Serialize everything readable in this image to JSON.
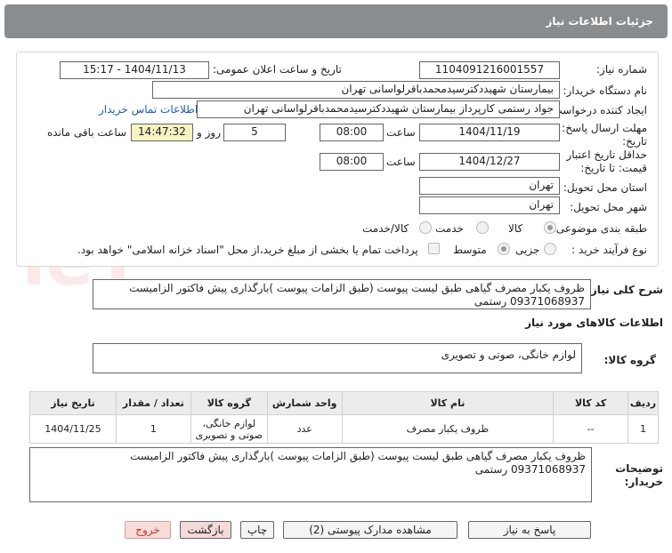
{
  "header": {
    "title": "جزئیات اطلاعات نیاز"
  },
  "form": {
    "need_number_label": "شماره نیاز:",
    "need_number": "1104091216001557",
    "announce_label": "تاریخ و ساعت اعلان عمومی:",
    "announce_value": "1404/11/13 - 15:17",
    "buyer_org_label": "نام دستگاه خریدار:",
    "buyer_org": "بیمارستان شهیددکترسیدمحمدباقرلواسانی تهران",
    "requester_label": "ایجاد کننده درخواست:",
    "requester": "جواد رستمی کارپرداز بیمارستان شهیددکترسیدمحمدباقرلواسانی تهران",
    "contact_link": "اطلاعات تماس خریدار",
    "deadline_label_1": "مهلت ارسال پاسخ: تا",
    "deadline_label_2": "تاریخ:",
    "deadline_date": "1404/11/19",
    "time_label": "ساعت",
    "deadline_time": "08:00",
    "days_value": "5",
    "days_label": "روز و",
    "remaining_time": "14:47:32",
    "remaining_label": "ساعت باقی مانده",
    "validity_label_1": "حداقل تاریخ اعتبار",
    "validity_label_2": "قیمت: تا تاریخ:",
    "validity_date": "1404/12/27",
    "validity_time_label": "ساعت",
    "validity_time": "08:00",
    "province_label": "استان محل تحویل:",
    "province": "تهران",
    "city_label": "شهر محل تحویل:",
    "city": "تهران",
    "category_label": "طبقه بندی موضوعی:",
    "category_options": [
      "کالا",
      "خدمت",
      "کالا/خدمت"
    ],
    "process_label": "نوع فرآیند خرید :",
    "process_options": [
      "جزیی",
      "متوسط"
    ],
    "payment_note": "پرداخت تمام یا بخشی از مبلغ خرید،از محل \"اسناد خزانه اسلامی\" خواهد بود."
  },
  "summary": {
    "label": "شرح کلی نیاز:",
    "text": "ظروف یکبار مصرف گیاهی طبق لیست پیوست (طبق الزامات پیوست )بارگذاری پیش فاکتور الزامیست\n09371068937 رستمی"
  },
  "goods_section": {
    "title": "اطلاعات کالاهای مورد نیاز",
    "group_label": "گروه کالا:",
    "group_value": "لوازم خانگی، صوتی و تصویری"
  },
  "table": {
    "headers": [
      "ردیف",
      "کد کالا",
      "نام کالا",
      "واحد شمارش",
      "گروه کالا",
      "تعداد / مقدار",
      "تاریخ نیاز"
    ],
    "rows": [
      {
        "row": "1",
        "code": "--",
        "name": "ظروف یکبار مصرف",
        "unit": "عدد",
        "group_line1": "لوازم خانگی،",
        "group_line2": "صوتی و تصویری",
        "qty": "1",
        "date": "1404/11/25"
      }
    ]
  },
  "buyer_notes": {
    "label_1": "توضیحات",
    "label_2": "خریدار:",
    "text": "ظروف یکبار مصرف گیاهی طبق لیست پیوست (طبق الزامات پیوست )بارگذاری پیش فاکتور الزامیست\n09371068937 رستمی"
  },
  "buttons": {
    "reply": "پاسخ به نیاز",
    "view_docs": "مشاهده مدارک پیوستی (2)",
    "print": "چاپ",
    "back": "بازگشت",
    "exit": "خروج"
  },
  "watermark": {
    "text": "AriaTender.neT"
  }
}
